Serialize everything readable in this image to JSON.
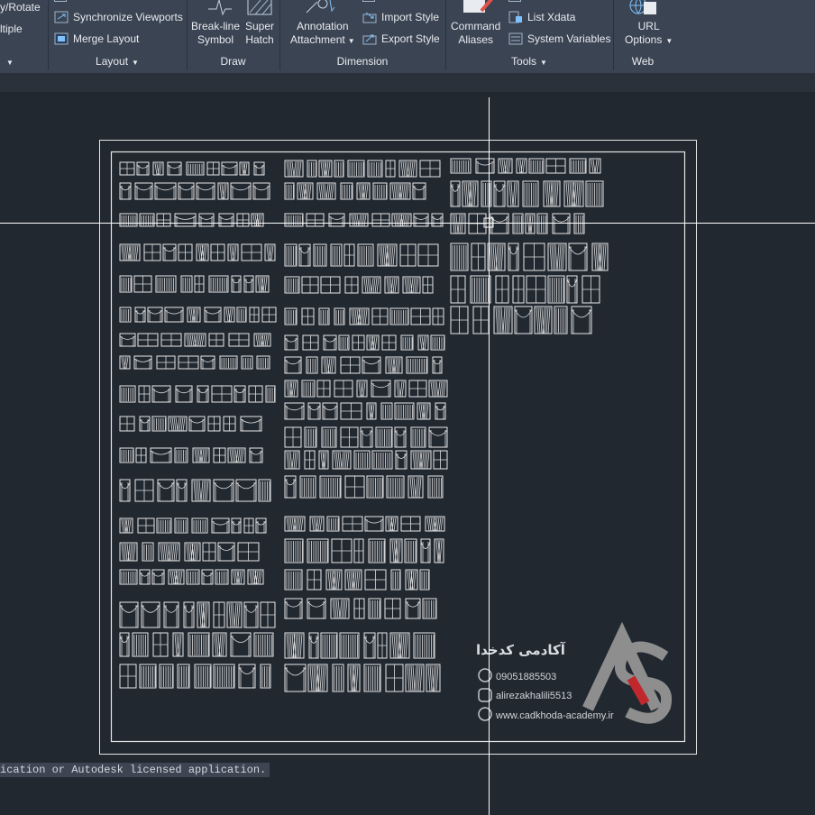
{
  "ribbon": {
    "panels": {
      "modify": {
        "items": [
          "y/Rotate",
          "ltiple"
        ]
      },
      "layout": {
        "sync_viewports": "Synchronize Viewports",
        "merge_layout": "Merge Layout",
        "label": "Layout"
      },
      "draw": {
        "breakline_1": "Break-line",
        "breakline_2": "Symbol",
        "superhatch_1": "Super",
        "superhatch_2": "Hatch",
        "label": "Draw"
      },
      "dimension": {
        "annot_1": "Annotation",
        "annot_2": "Attachment",
        "import_style": "Import Style",
        "export_style": "Export Style",
        "label": "Dimension"
      },
      "tools": {
        "cmd_1": "Command",
        "cmd_2": "Aliases",
        "list_xdata": "List Xdata",
        "system_variables": "System Variables",
        "label": "Tools"
      },
      "web": {
        "url_1": "URL",
        "url_2": "Options",
        "label": "Web"
      }
    }
  },
  "canvas": {
    "background_color": "#212830",
    "crosshair_color": "#ffffff",
    "watermark": {
      "title_fa": "آکادمی کدخدا",
      "phone": "09051885503",
      "instagram": "alirezakhalili5513",
      "website": "www.cadkhoda-academy.ir",
      "logo": "AS-logo"
    }
  },
  "command_line": {
    "text": "ication or Autodesk licensed application."
  }
}
